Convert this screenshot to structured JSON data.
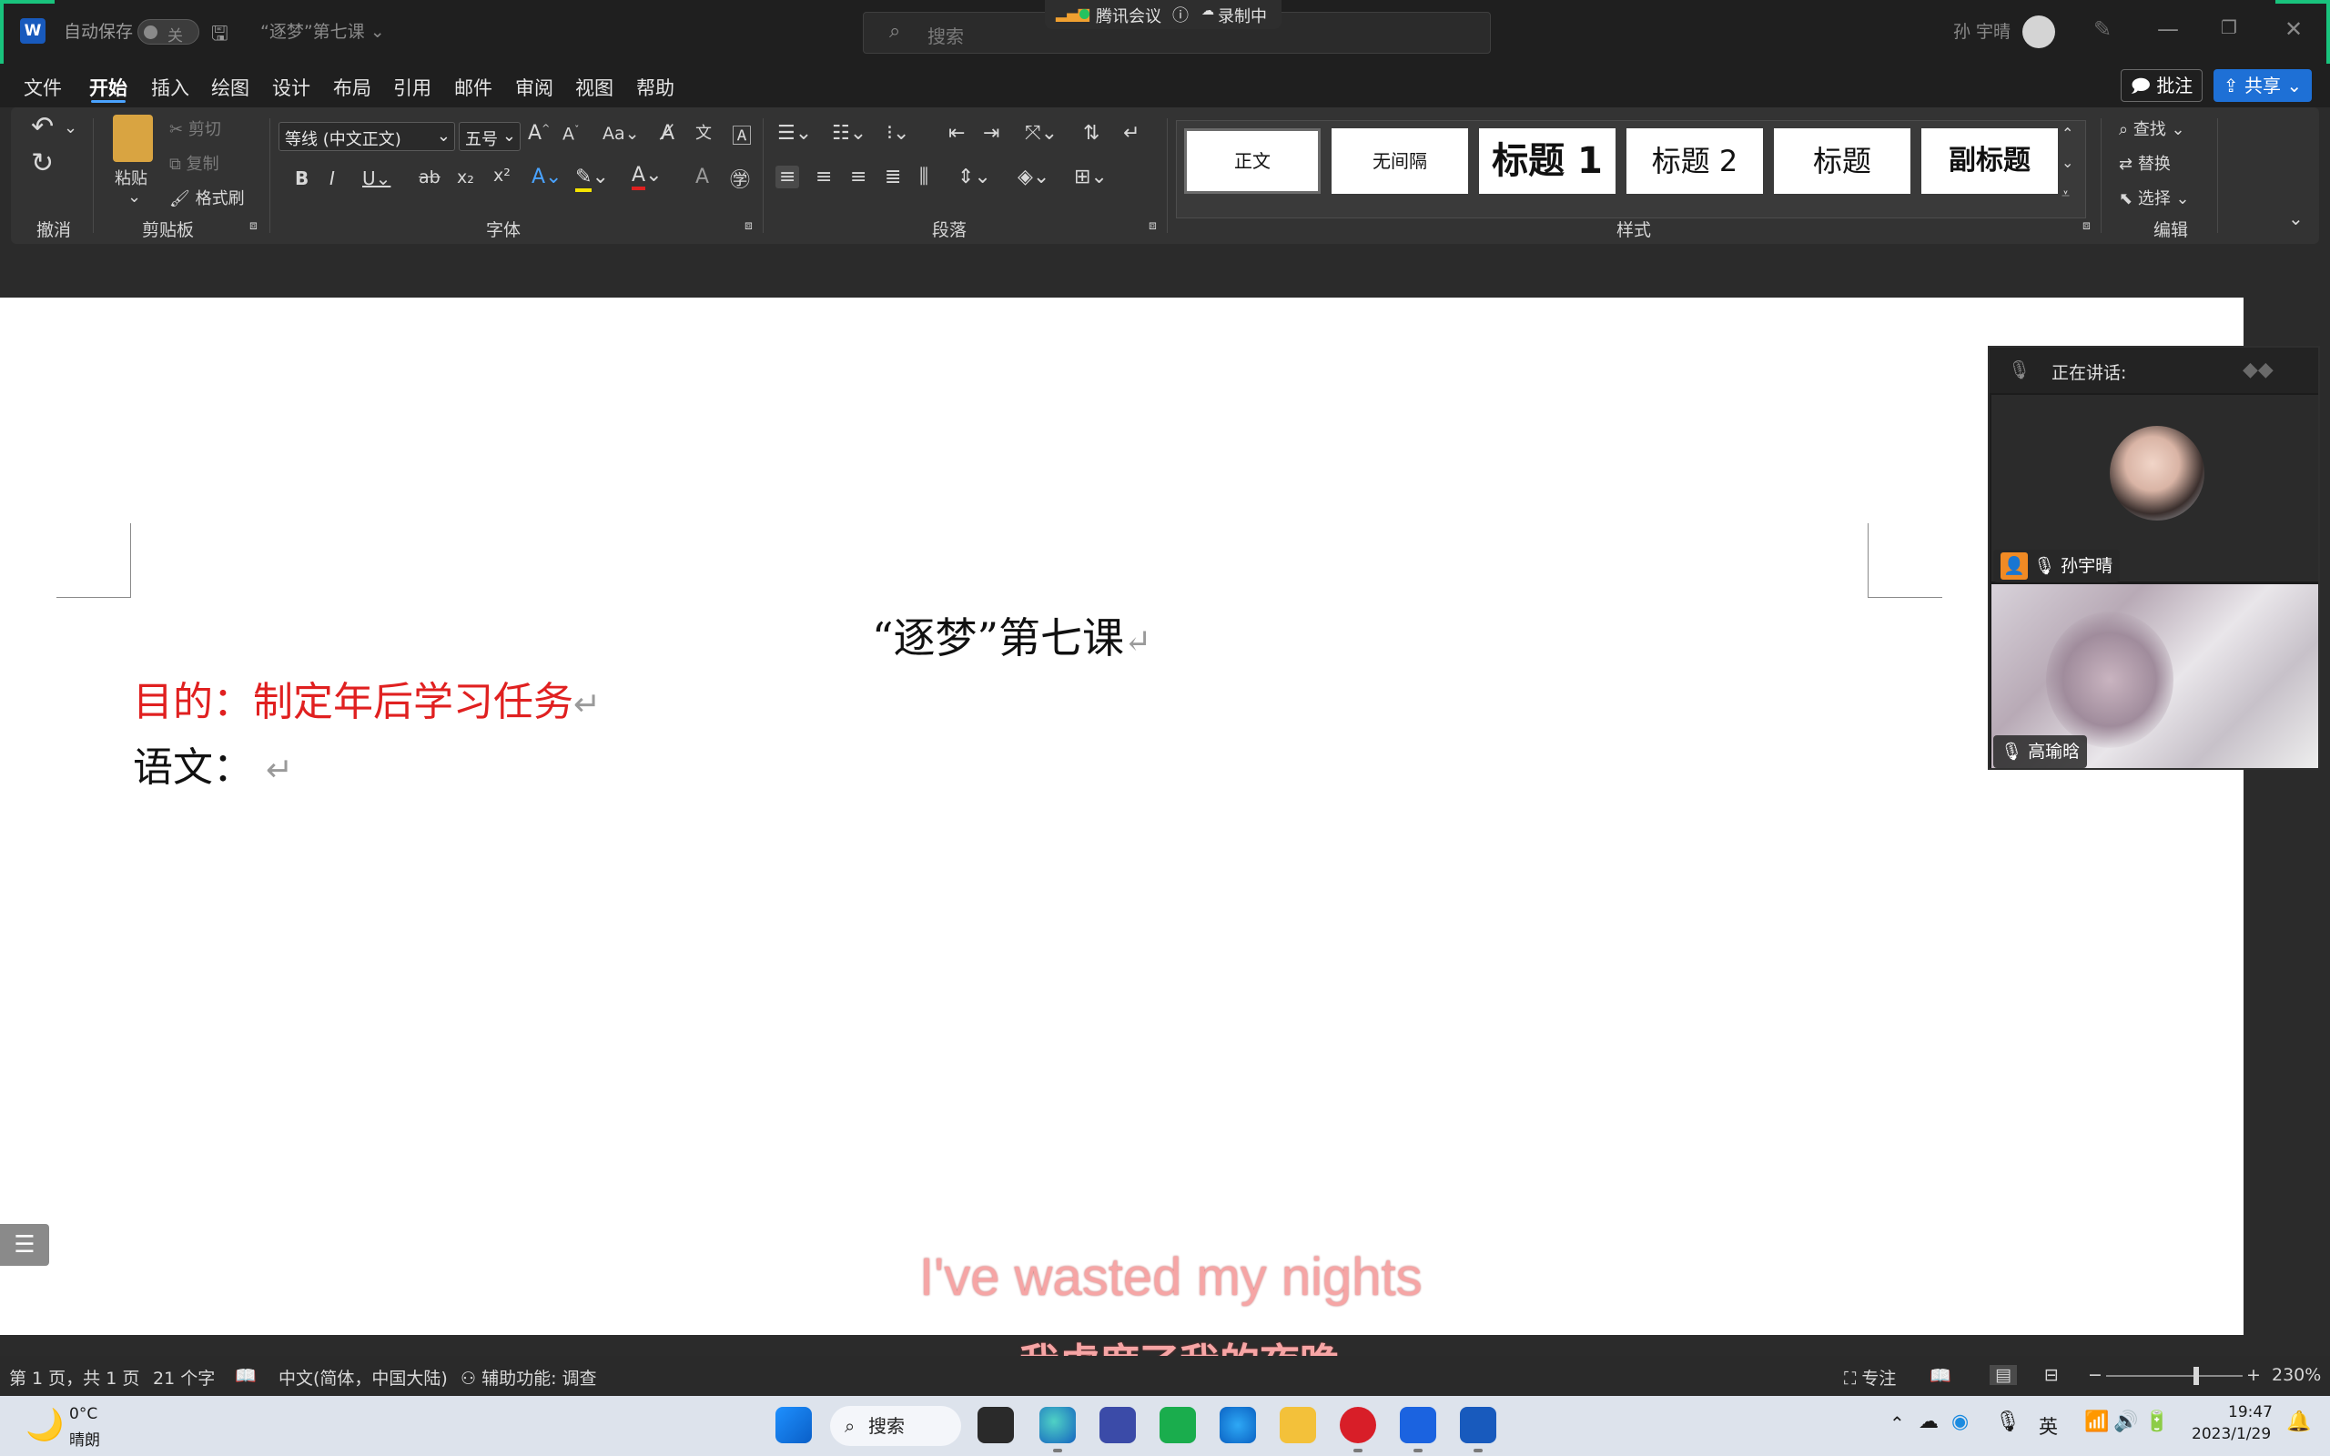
{
  "titlebar": {
    "autosave_label": "自动保存",
    "autosave_state": "关",
    "doc_title": "“逐梦”第七课",
    "search_placeholder": "搜索",
    "meeting_app": "腾讯会议",
    "recording": "录制中",
    "user_name": "孙 宇晴"
  },
  "menu": {
    "items": [
      "文件",
      "开始",
      "插入",
      "绘图",
      "设计",
      "布局",
      "引用",
      "邮件",
      "审阅",
      "视图",
      "帮助"
    ],
    "active": "开始",
    "comment_btn": "批注",
    "share_btn": "共享"
  },
  "ribbon": {
    "undo_group": "撤消",
    "clipboard_group": "剪贴板",
    "paste": "粘贴",
    "cut": "剪切",
    "copy": "复制",
    "format_painter": "格式刷",
    "font_group": "字体",
    "font_name": "等线 (中文正文)",
    "font_size": "五号",
    "paragraph_group": "段落",
    "styles_group": "样式",
    "styles": [
      "正文",
      "无间隔",
      "标题 1",
      "标题 2",
      "标题",
      "副标题"
    ],
    "editing_group": "编辑",
    "find": "查找",
    "replace": "替换",
    "select": "选择"
  },
  "document": {
    "title": "“逐梦”第七课",
    "line1": "目的：制定年后学习任务",
    "line2": "语文：",
    "pilcrow": "↵",
    "accent_red": "#e02020"
  },
  "subtitles": {
    "english": "I've wasted my nights",
    "chinese": "我虚度了我的夜晚"
  },
  "meeting_panel": {
    "speaking_label": "正在讲话:",
    "participant1": "孙宇晴",
    "participant2": "高瑜晗"
  },
  "statusbar": {
    "page": "第 1 页，共 1 页",
    "words": "21 个字",
    "language": "中文(简体，中国大陆)",
    "accessibility": "辅助功能: 调查",
    "focus": "专注",
    "zoom": "230%"
  },
  "taskbar": {
    "weather_temp": "0°C",
    "weather_desc": "晴朗",
    "search_label": "搜索",
    "ime": "英",
    "time": "19:47",
    "date": "2023/1/29"
  }
}
